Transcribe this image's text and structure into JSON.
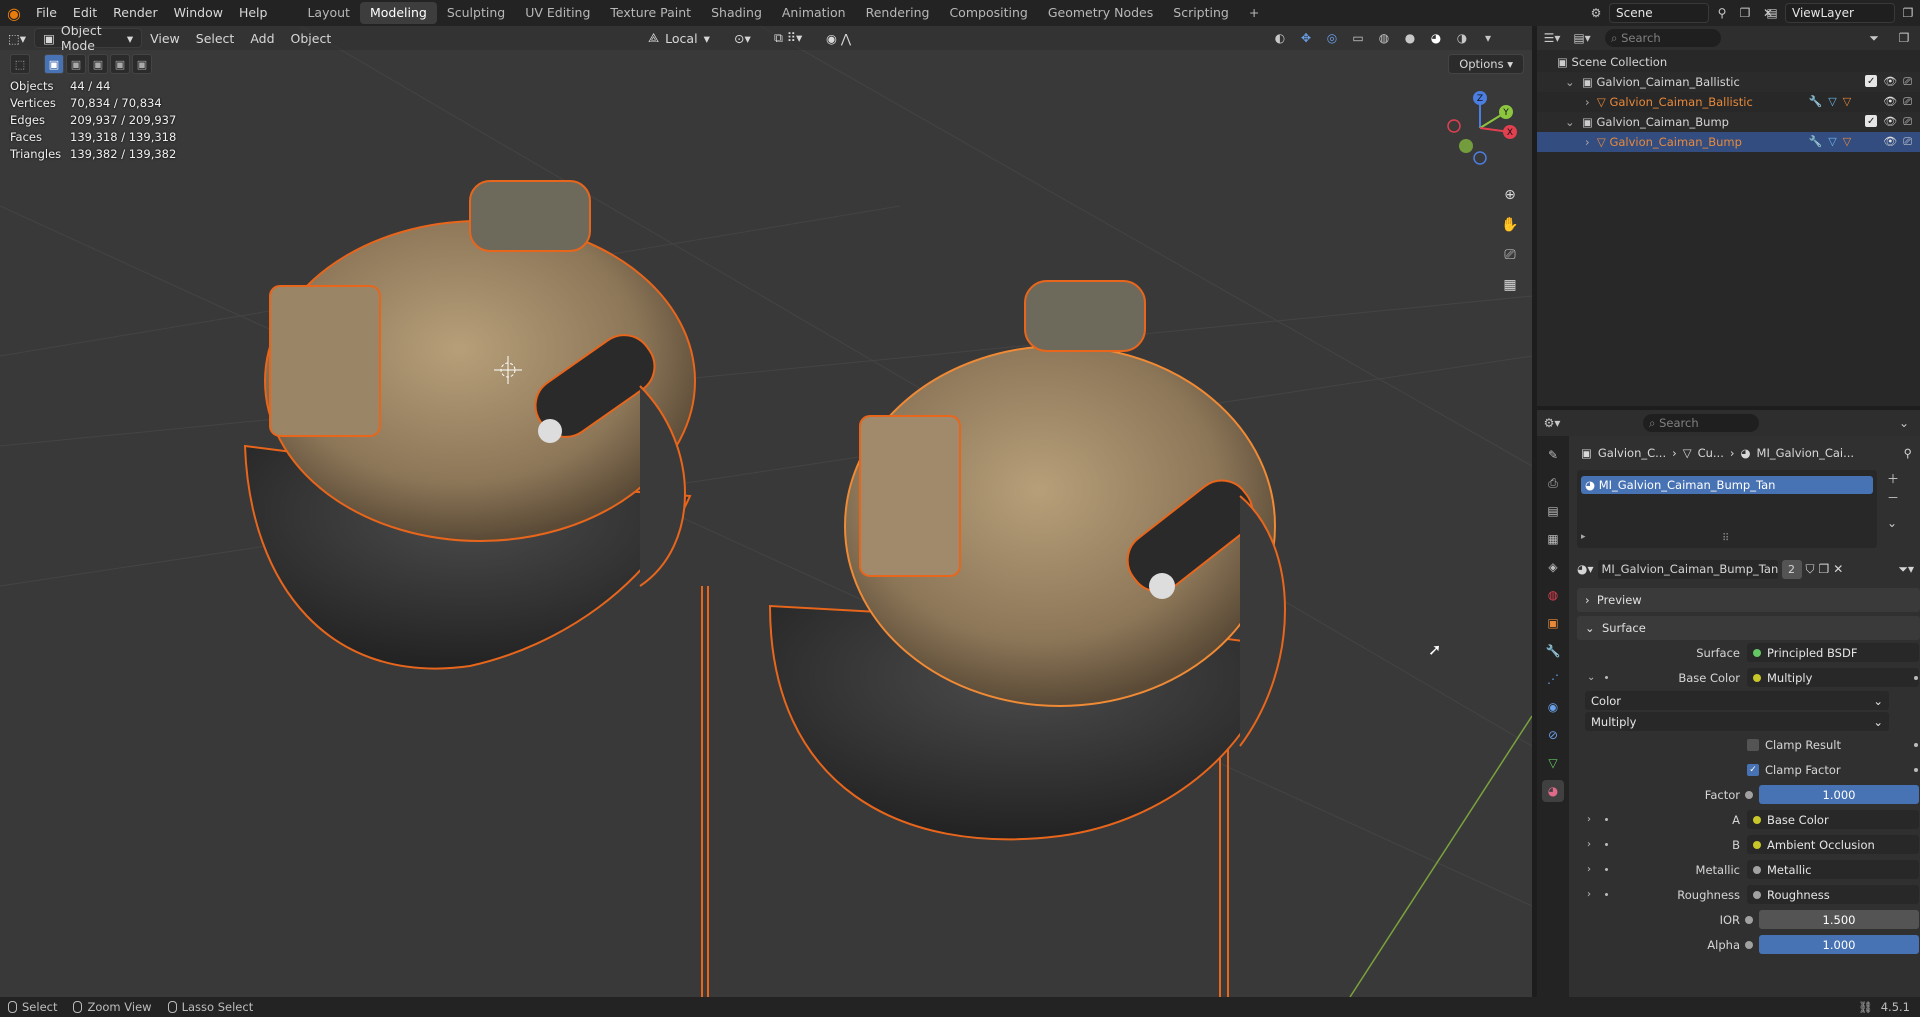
{
  "topbar": {
    "menus": [
      "File",
      "Edit",
      "Render",
      "Window",
      "Help"
    ],
    "workspaces": [
      "Layout",
      "Modeling",
      "Sculpting",
      "UV Editing",
      "Texture Paint",
      "Shading",
      "Animation",
      "Rendering",
      "Compositing",
      "Geometry Nodes",
      "Scripting"
    ],
    "active_workspace": "Modeling",
    "add_workspace": "+",
    "scene": "Scene",
    "view_layer": "ViewLayer"
  },
  "viewport": {
    "mode": "Object Mode",
    "menus": [
      "View",
      "Select",
      "Add",
      "Object"
    ],
    "transform_orientation": "Local",
    "options": "Options",
    "stats": [
      {
        "label": "Objects",
        "value": "44 / 44"
      },
      {
        "label": "Vertices",
        "value": "70,834 / 70,834"
      },
      {
        "label": "Edges",
        "value": "209,937 / 209,937"
      },
      {
        "label": "Faces",
        "value": "139,318 / 139,318"
      },
      {
        "label": "Triangles",
        "value": "139,382 / 139,382"
      }
    ],
    "gizmo": {
      "x": "X",
      "y": "Y",
      "z": "Z"
    }
  },
  "outliner": {
    "search_placeholder": "Search",
    "root": "Scene Collection",
    "items": [
      {
        "label": "Galvion_Caiman_Ballistic",
        "type": "collection"
      },
      {
        "label": "Galvion_Caiman_Ballistic",
        "type": "object"
      },
      {
        "label": "Galvion_Caiman_Bump",
        "type": "collection"
      },
      {
        "label": "Galvion_Caiman_Bump",
        "type": "object"
      }
    ]
  },
  "properties": {
    "search_placeholder": "Search",
    "breadcrumb": [
      "Galvion_C...",
      "Cu...",
      "MI_Galvion_Cai..."
    ],
    "slot": "MI_Galvion_Caiman_Bump_Tan",
    "material_name": "MI_Galvion_Caiman_Bump_Tan",
    "user_count": "2",
    "panels": {
      "preview": "Preview",
      "surface": "Surface"
    },
    "rows": {
      "surface": {
        "label": "Surface",
        "value": "Principled BSDF"
      },
      "base_color": {
        "label": "Base Color",
        "value": "Multiply"
      },
      "color_type": "Color",
      "blend_type": "Multiply",
      "clamp_result": "Clamp Result",
      "clamp_factor": "Clamp Factor",
      "factor": {
        "label": "Factor",
        "value": "1.000"
      },
      "a": {
        "label": "A",
        "value": "Base Color"
      },
      "b": {
        "label": "B",
        "value": "Ambient Occlusion"
      },
      "metallic": {
        "label": "Metallic",
        "value": "Metallic"
      },
      "roughness": {
        "label": "Roughness",
        "value": "Roughness"
      },
      "ior": {
        "label": "IOR",
        "value": "1.500"
      },
      "alpha": {
        "label": "Alpha",
        "value": "1.000"
      }
    }
  },
  "statusbar": {
    "items": [
      "Select",
      "Zoom View",
      "Lasso Select"
    ],
    "version": "4.5.1"
  }
}
